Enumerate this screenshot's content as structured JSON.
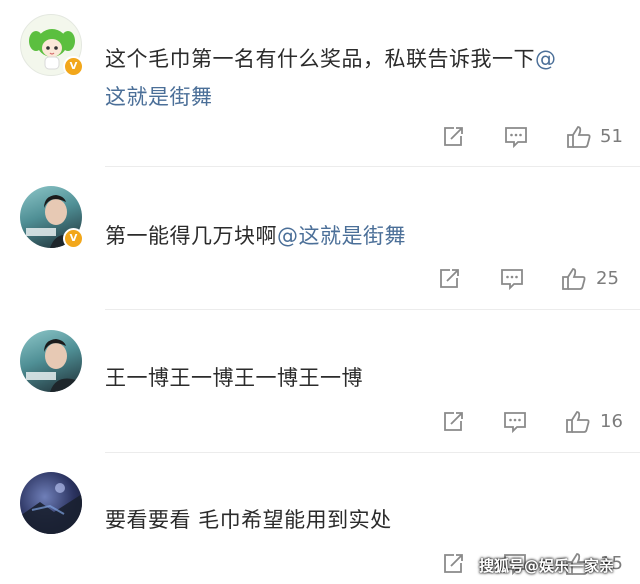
{
  "comments": [
    {
      "text": "这个毛巾第一名有什么奖品，私联告诉我一下",
      "mention_inline": "@",
      "mention_line2": "这就是街舞",
      "likes": "51",
      "avatar": "cartoon-girl-avatar"
    },
    {
      "text": "第一能得几万块啊",
      "mention": "@这就是街舞",
      "likes": "25",
      "avatar": "photo-avatar"
    },
    {
      "text": "王一博王一博王一博王一博",
      "likes": "16",
      "avatar": "photo-avatar"
    },
    {
      "text": "要看要看 毛巾希望能用到实处",
      "likes": "15",
      "avatar": "dark-avatar"
    }
  ],
  "watermark": "搜狐号@娱乐一家亲",
  "colors": {
    "mention": "#4b6f98",
    "text": "#2b2b2b",
    "icon": "#8a8a8a",
    "verify": "#f2a71b"
  }
}
